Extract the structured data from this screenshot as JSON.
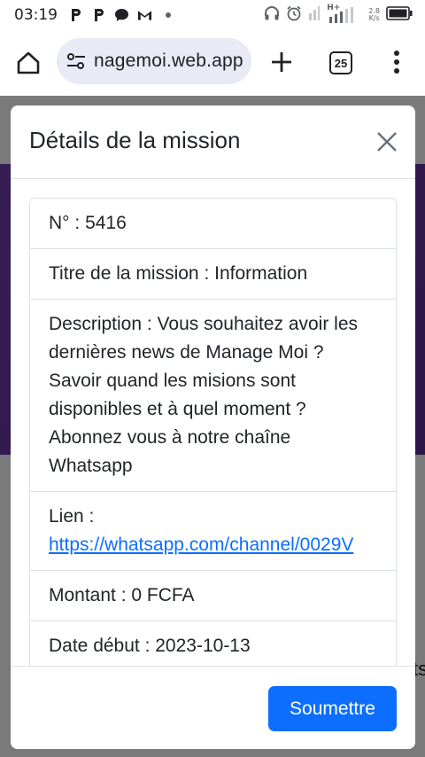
{
  "status_bar": {
    "time": "03:19",
    "notifications": [
      "p-app-icon",
      "p-app-icon",
      "chat-bubble-icon",
      "gmail-icon",
      "dot-icon"
    ],
    "net_speed_value": "2.8",
    "net_speed_unit": "K/s",
    "network_label": "H+"
  },
  "browser": {
    "url": "nagemoi.web.app",
    "tab_count": "25"
  },
  "page": {
    "stub_text": "ts"
  },
  "modal": {
    "title": "Détails de la mission",
    "number": "N° : 5416",
    "mission_title": "Titre de la mission : Information",
    "description": "Description : Vous souhaitez avoir les dernières news de Manage Moi ? Savoir quand les misions sont disponibles et à quel moment ? Abonnez vous à notre chaîne Whatsapp",
    "link_label": "Lien :",
    "link_url": "https://whatsapp.com/channel/0029V",
    "amount": "Montant : 0 FCFA",
    "start_date": "Date début : 2023-10-13",
    "submit_label": "Soumettre"
  },
  "colors": {
    "primary": "#0d6efd",
    "band": "#6d3aa6"
  }
}
